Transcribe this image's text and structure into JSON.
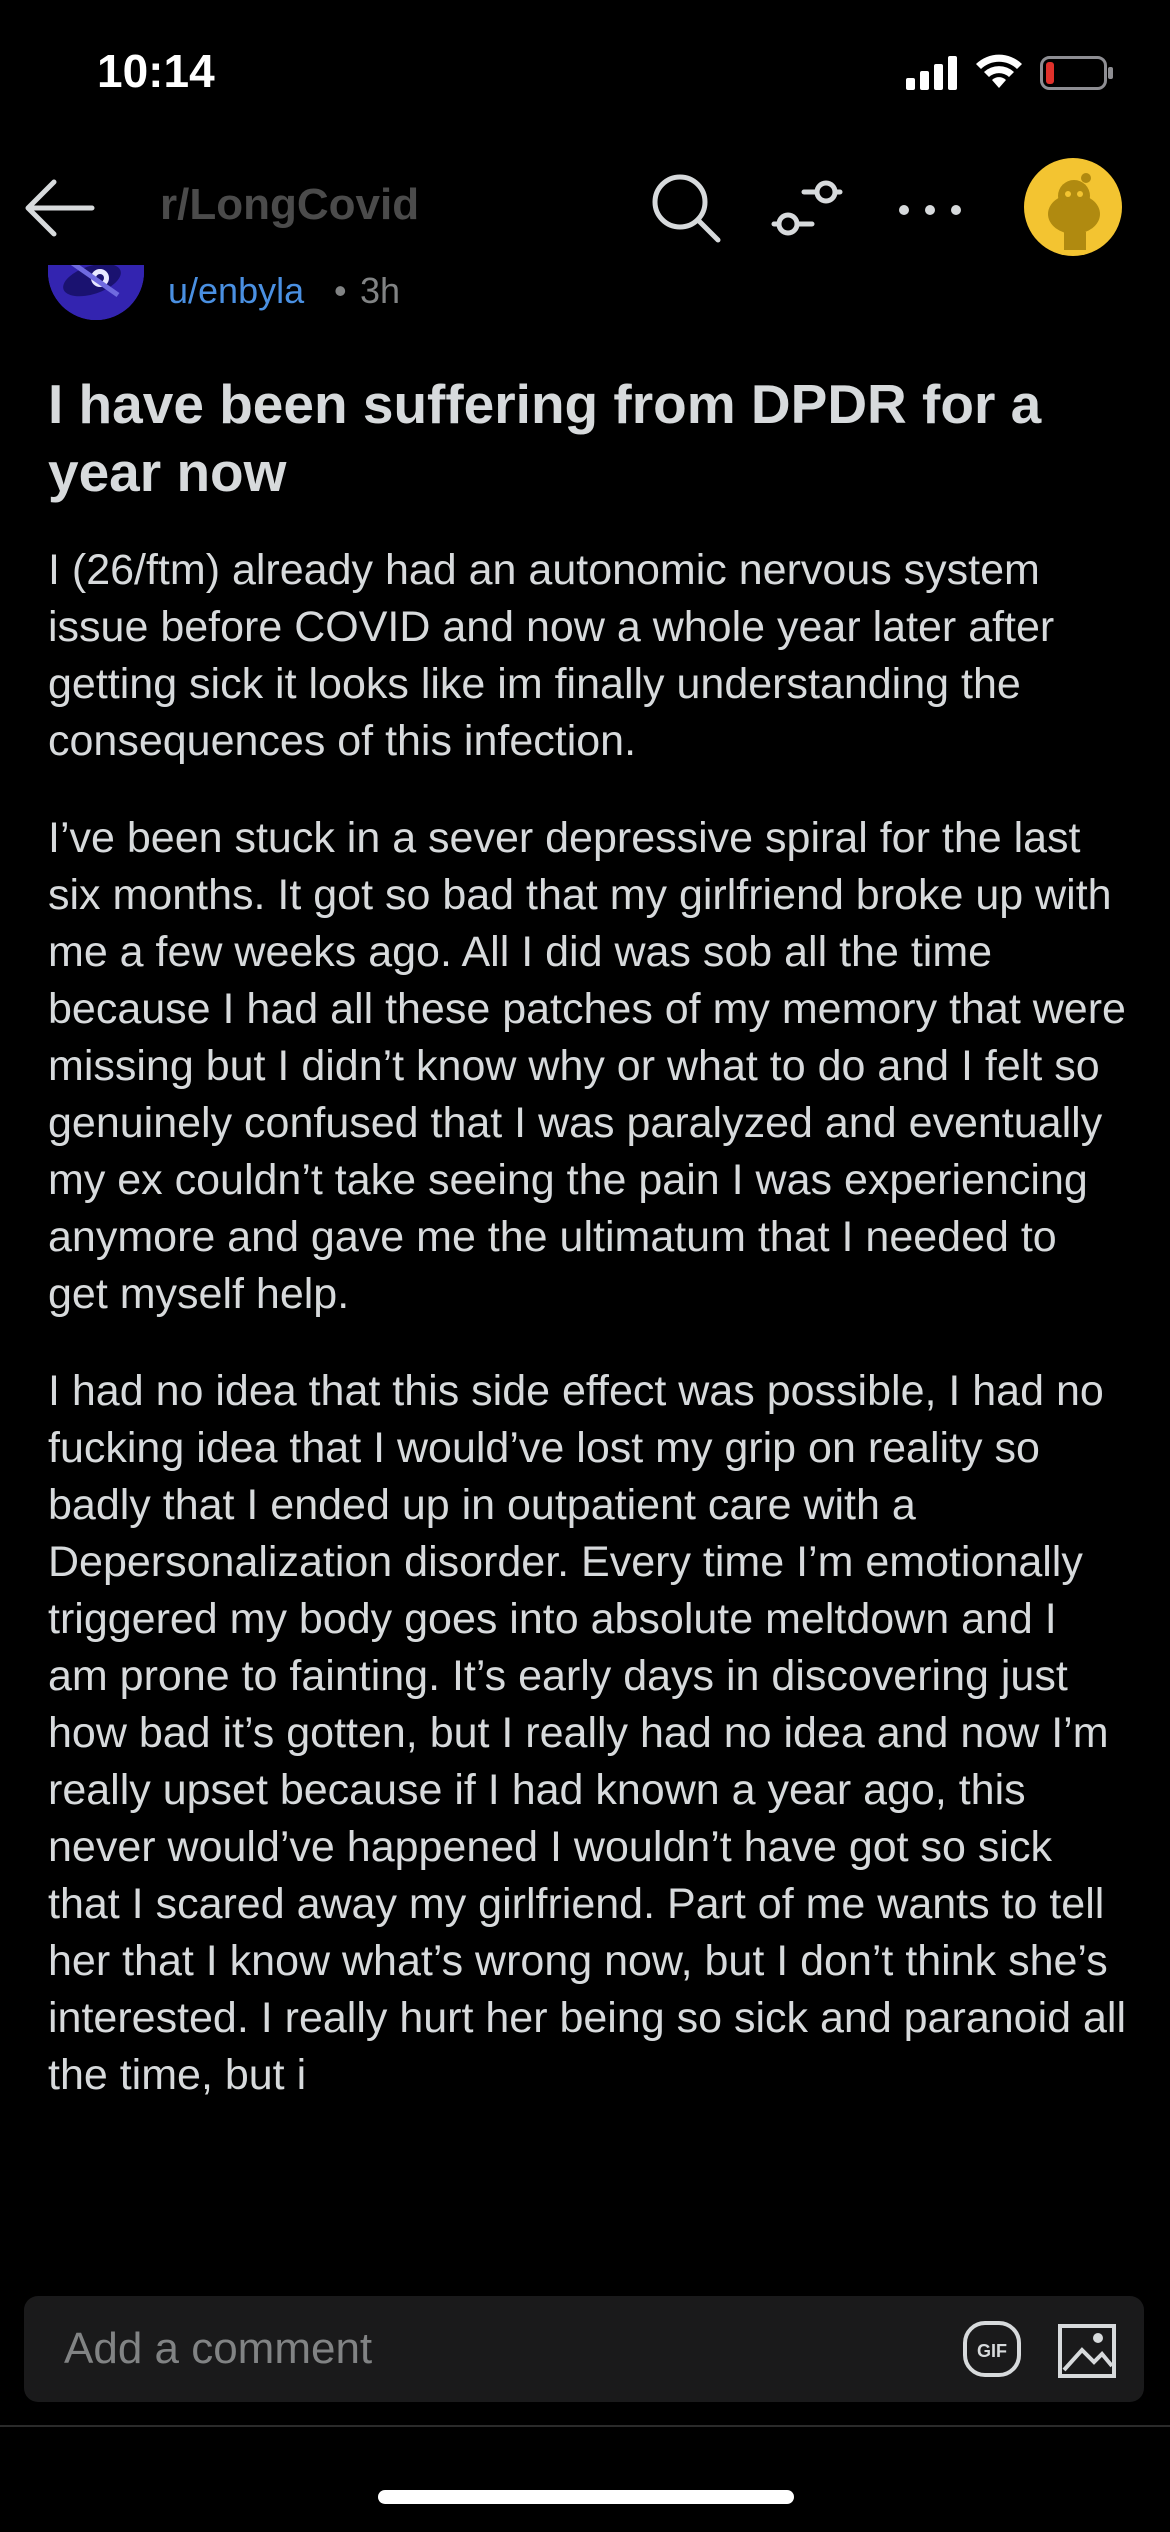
{
  "status_bar": {
    "time": "10:14"
  },
  "header": {
    "community": "r/LongCovid",
    "icons": [
      "back-arrow-icon",
      "search-icon",
      "filter-icon",
      "more-icon",
      "user-avatar"
    ]
  },
  "post": {
    "author": "u/enbyla",
    "separator": "•",
    "time_ago": "3h",
    "title": "I have been suffering from DPDR for a year now",
    "body": [
      "I (26/ftm) already had an autonomic nervous system issue before COVID and now a whole year later after getting sick it looks like im finally understanding the consequences of this infection.",
      "I’ve been stuck in a sever depressive spiral for the last six months. It got so bad that my girlfriend broke up with me a few weeks ago. All I did was sob all the time because I had all these patches of my memory that were missing but I didn’t know why or what to do and I felt so genuinely confused that I was paralyzed and eventually my ex couldn’t take seeing the pain I was experiencing anymore and gave me the ultimatum that I needed to get myself help.",
      "I had no idea that this side effect was possible, I had no fucking idea that I would’ve lost my grip on reality so badly that I ended up in outpatient care with a Depersonalization disorder. Every time I’m emotionally triggered my body goes into absolute meltdown and I am prone to fainting. It’s early days in discovering just how bad it’s gotten, but I really had no idea and now I’m really upset because if I had known a year ago, this never would’ve happened I wouldn’t have got so sick that I scared away my girlfriend. Part of me wants to tell her that I know what’s wrong now, but I don’t think she’s interested. I really hurt her being so sick and paranoid all the time, but i"
    ]
  },
  "comment_bar": {
    "placeholder": "Add a comment",
    "gif_label": "GIF"
  },
  "colors": {
    "background": "#000000",
    "text": "#d7dadc",
    "author_link": "#4a90e2",
    "muted": "#818384",
    "avatar_bg": "#f3c431",
    "battery_low": "#e0312b"
  }
}
